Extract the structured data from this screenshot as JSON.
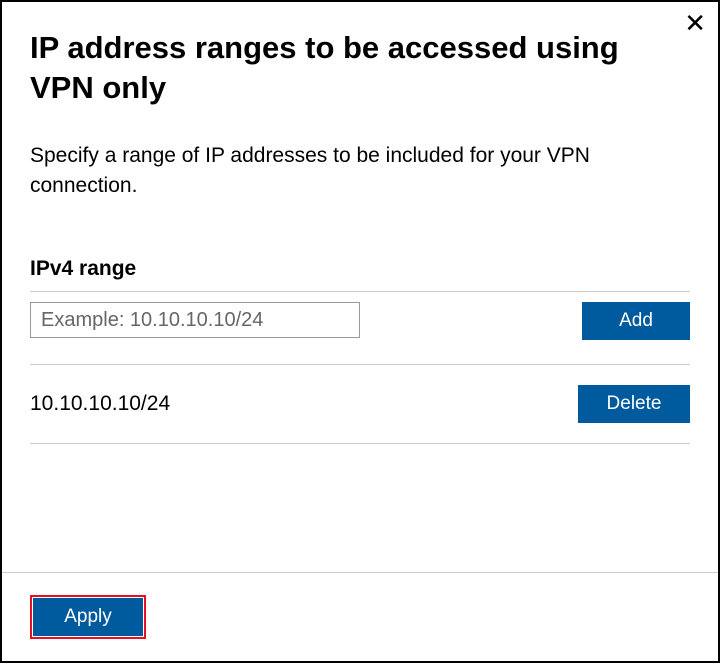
{
  "dialog": {
    "title": "IP address ranges to be accessed using VPN only",
    "description": "Specify a range of IP addresses to be included for your VPN connection.",
    "close_label": "✕"
  },
  "section": {
    "label": "IPv4 range",
    "input_placeholder": "Example: 10.10.10.10/24",
    "add_button": "Add",
    "delete_button": "Delete",
    "entries": [
      {
        "value": "10.10.10.10/24"
      }
    ]
  },
  "footer": {
    "apply_button": "Apply"
  }
}
